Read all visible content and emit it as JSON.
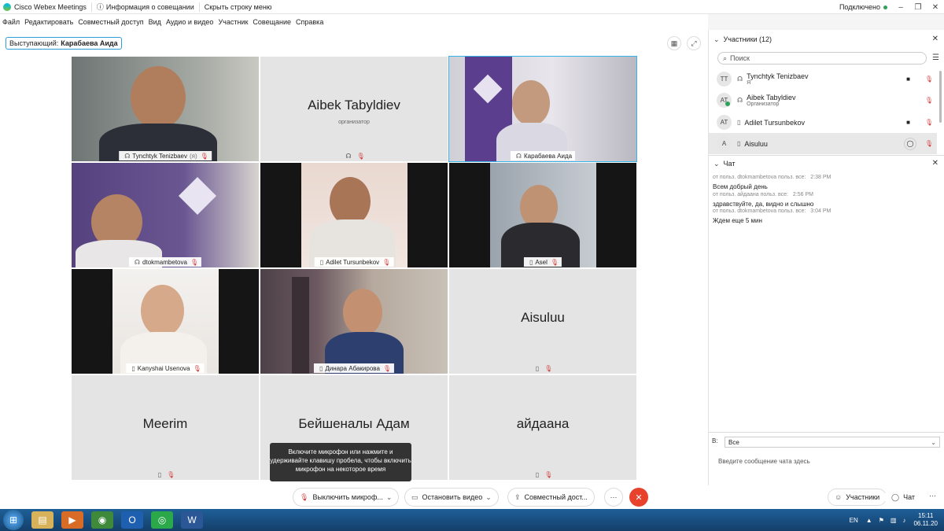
{
  "app": {
    "title": "Cisco Webex Meetings",
    "info": "Информация о совещании",
    "hide_menu": "Скрыть строку меню",
    "status": "Подключено"
  },
  "menu": [
    "Файл",
    "Редактировать",
    "Совместный доступ",
    "Вид",
    "Аудио и видео",
    "Участник",
    "Совещание",
    "Справка"
  ],
  "speaker": {
    "prefix": "Выступающий:",
    "name": "Карабаева Аида"
  },
  "tiles": [
    {
      "name": "Tynchtyk Tenizbaev",
      "suffix": "(я)"
    },
    {
      "name": "Aibek Tabyldiev",
      "role": "организатор"
    },
    {
      "name": "Карабаева Аида"
    },
    {
      "name": "dtokmambetova"
    },
    {
      "name": "Adilet Tursunbekov"
    },
    {
      "name": "Asel"
    },
    {
      "name": "Kanyshai Usenova"
    },
    {
      "name": "Динара Абакирова"
    },
    {
      "name": "Aisuluu"
    },
    {
      "name": "Meerim"
    },
    {
      "name": "Бейшеналы Адам"
    },
    {
      "name": "айдаана"
    }
  ],
  "tooltip": "Включите микрофон или нажмите и удерживайте клавишу пробела, чтобы включить микрофон на некоторое время",
  "controls": {
    "unmute": "Выключить микроф...",
    "stop_video": "Остановить видео",
    "share": "Совместный дост...",
    "participants": "Участники",
    "chat": "Чат"
  },
  "participants_panel": {
    "title": "Участники (12)",
    "search_placeholder": "Поиск",
    "list": [
      {
        "initials": "TT",
        "name": "Tynchtyk Tenizbaev",
        "role": "Я"
      },
      {
        "initials": "AT",
        "name": "Aibek Tabyldiev",
        "role": "Организатор"
      },
      {
        "initials": "AT",
        "name": "Adilet Tursunbekov",
        "role": ""
      },
      {
        "initials": "A",
        "name": "Aisuluu",
        "role": ""
      }
    ]
  },
  "chat_panel": {
    "title": "Чат",
    "messages": [
      {
        "meta": "от польз. dtokmambetova польз. все:",
        "time": "2:38 PM",
        "text": "Всем добрый день"
      },
      {
        "meta": "от польз. айдаана польз. все:",
        "time": "2:56 PM",
        "text": "здравствуйте, да, видно и слышно"
      },
      {
        "meta": "от польз. dtokmambetova польз. все:",
        "time": "3:04 PM",
        "text": "Ждем еще 5 мин"
      }
    ],
    "to_label": "В:",
    "to_value": "Все",
    "input_placeholder": "Введите сообщение чата здесь"
  },
  "taskbar": {
    "lang": "EN",
    "time": "15:11",
    "date": "06.11.20"
  },
  "colors": {
    "accent": "#2e9ed8",
    "end_call": "#e8412c",
    "muted": "#d23b3b",
    "active_border": "#39b4e6"
  }
}
